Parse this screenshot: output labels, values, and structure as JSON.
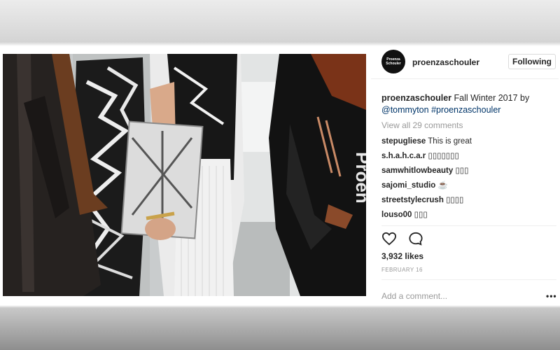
{
  "post": {
    "avatar_text": [
      "Proenza",
      "Schouler"
    ],
    "username": "proenzaschouler",
    "follow_label": "Following",
    "caption": {
      "username": "proenzaschouler",
      "text": "Fall Winter 2017 by",
      "mention": "@tommyton",
      "hashtag": "#proenzaschouler"
    },
    "view_all": "View all 29 comments",
    "comments": [
      {
        "user": "stepugliese",
        "text": "This is great"
      },
      {
        "user": "s.h.a.h.c.a.r",
        "text": "▯▯▯▯▯▯▯"
      },
      {
        "user": "samwhitlowbeauty",
        "text": "▯▯▯"
      },
      {
        "user": "sajomi_studio",
        "text": "☕"
      },
      {
        "user": "streetstylecrush",
        "text": "▯▯▯▯"
      },
      {
        "user": "louso00",
        "text": "▯▯▯"
      }
    ],
    "icons": [
      "heart-icon",
      "comment-icon"
    ],
    "likes": "3,932 likes",
    "date": "FEBRUARY 16",
    "add_comment_placeholder": "Add a comment...",
    "more_label": "•••"
  }
}
